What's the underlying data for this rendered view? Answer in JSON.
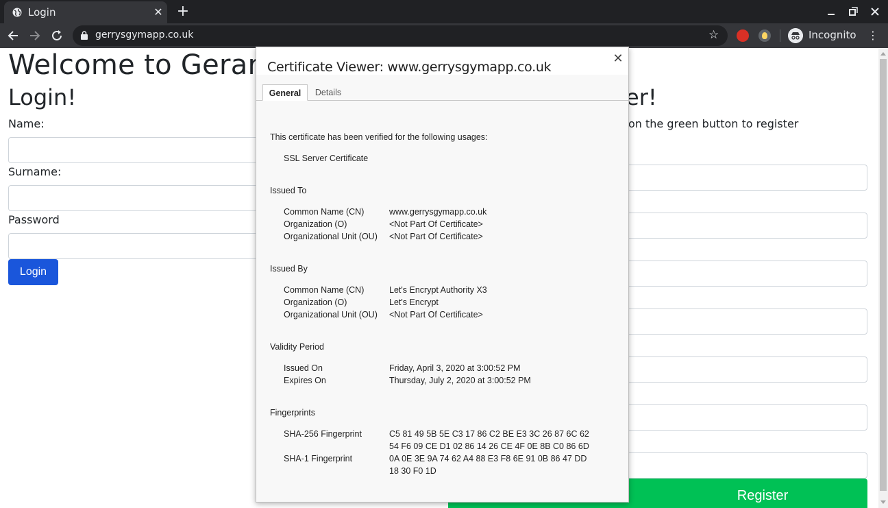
{
  "browser": {
    "tab_title": "Login",
    "tab_close": "✕",
    "new_tab": "+",
    "url": "gerrysgymapp.co.uk",
    "bookmark_star": "☆",
    "profile_label": "Incognito",
    "menu_glyph": "⋮"
  },
  "page": {
    "welcome_heading": "Welcome to Gerardo",
    "login_heading": "Login!",
    "name_label": "Name:",
    "surname_label": "Surname:",
    "password_label": "Password",
    "login_button": "Login",
    "register_heading_visible": "er!",
    "register_hint_visible": "on the green button to register",
    "register_button": "Register"
  },
  "dialog": {
    "title": "Certificate Viewer: www.gerrysgymapp.co.uk",
    "close_glyph": "✕",
    "tabs": [
      "General",
      "Details"
    ],
    "active_tab": "General",
    "verified_text": "This certificate has been verified for the following usages:",
    "usage": "SSL Server Certificate",
    "issued_to": {
      "heading": "Issued To",
      "rows": [
        {
          "label": "Common Name (CN)",
          "value": "www.gerrysgymapp.co.uk"
        },
        {
          "label": "Organization (O)",
          "value": "<Not Part Of Certificate>"
        },
        {
          "label": "Organizational Unit (OU)",
          "value": "<Not Part Of Certificate>"
        }
      ]
    },
    "issued_by": {
      "heading": "Issued By",
      "rows": [
        {
          "label": "Common Name (CN)",
          "value": "Let's Encrypt Authority X3"
        },
        {
          "label": "Organization (O)",
          "value": "Let's Encrypt"
        },
        {
          "label": "Organizational Unit (OU)",
          "value": "<Not Part Of Certificate>"
        }
      ]
    },
    "validity": {
      "heading": "Validity Period",
      "rows": [
        {
          "label": "Issued On",
          "value": "Friday, April 3, 2020 at 3:00:52 PM"
        },
        {
          "label": "Expires On",
          "value": "Thursday, July 2, 2020 at 3:00:52 PM"
        }
      ]
    },
    "fingerprints": {
      "heading": "Fingerprints",
      "sha256_label": "SHA-256 Fingerprint",
      "sha256_line1": "C5 81 49 5B 5E C3 17 86 C2 BE E3 3C 26 87 6C 62",
      "sha256_line2": "54 F6 09 CE D1 02 86 14 26 CE 4F 0E 8B C0 86 6D",
      "sha1_label": "SHA-1 Fingerprint",
      "sha1_line1": "0A 0E 3E 9A 74 62 A4 88 E3 F8 6E 91 0B 86 47 DD",
      "sha1_line2": "18 30 F0 1D"
    }
  },
  "colors": {
    "chrome_dark": "#202124",
    "chrome_toolbar": "#35363a",
    "login_button": "#1a56db",
    "register_button": "#00c155"
  }
}
